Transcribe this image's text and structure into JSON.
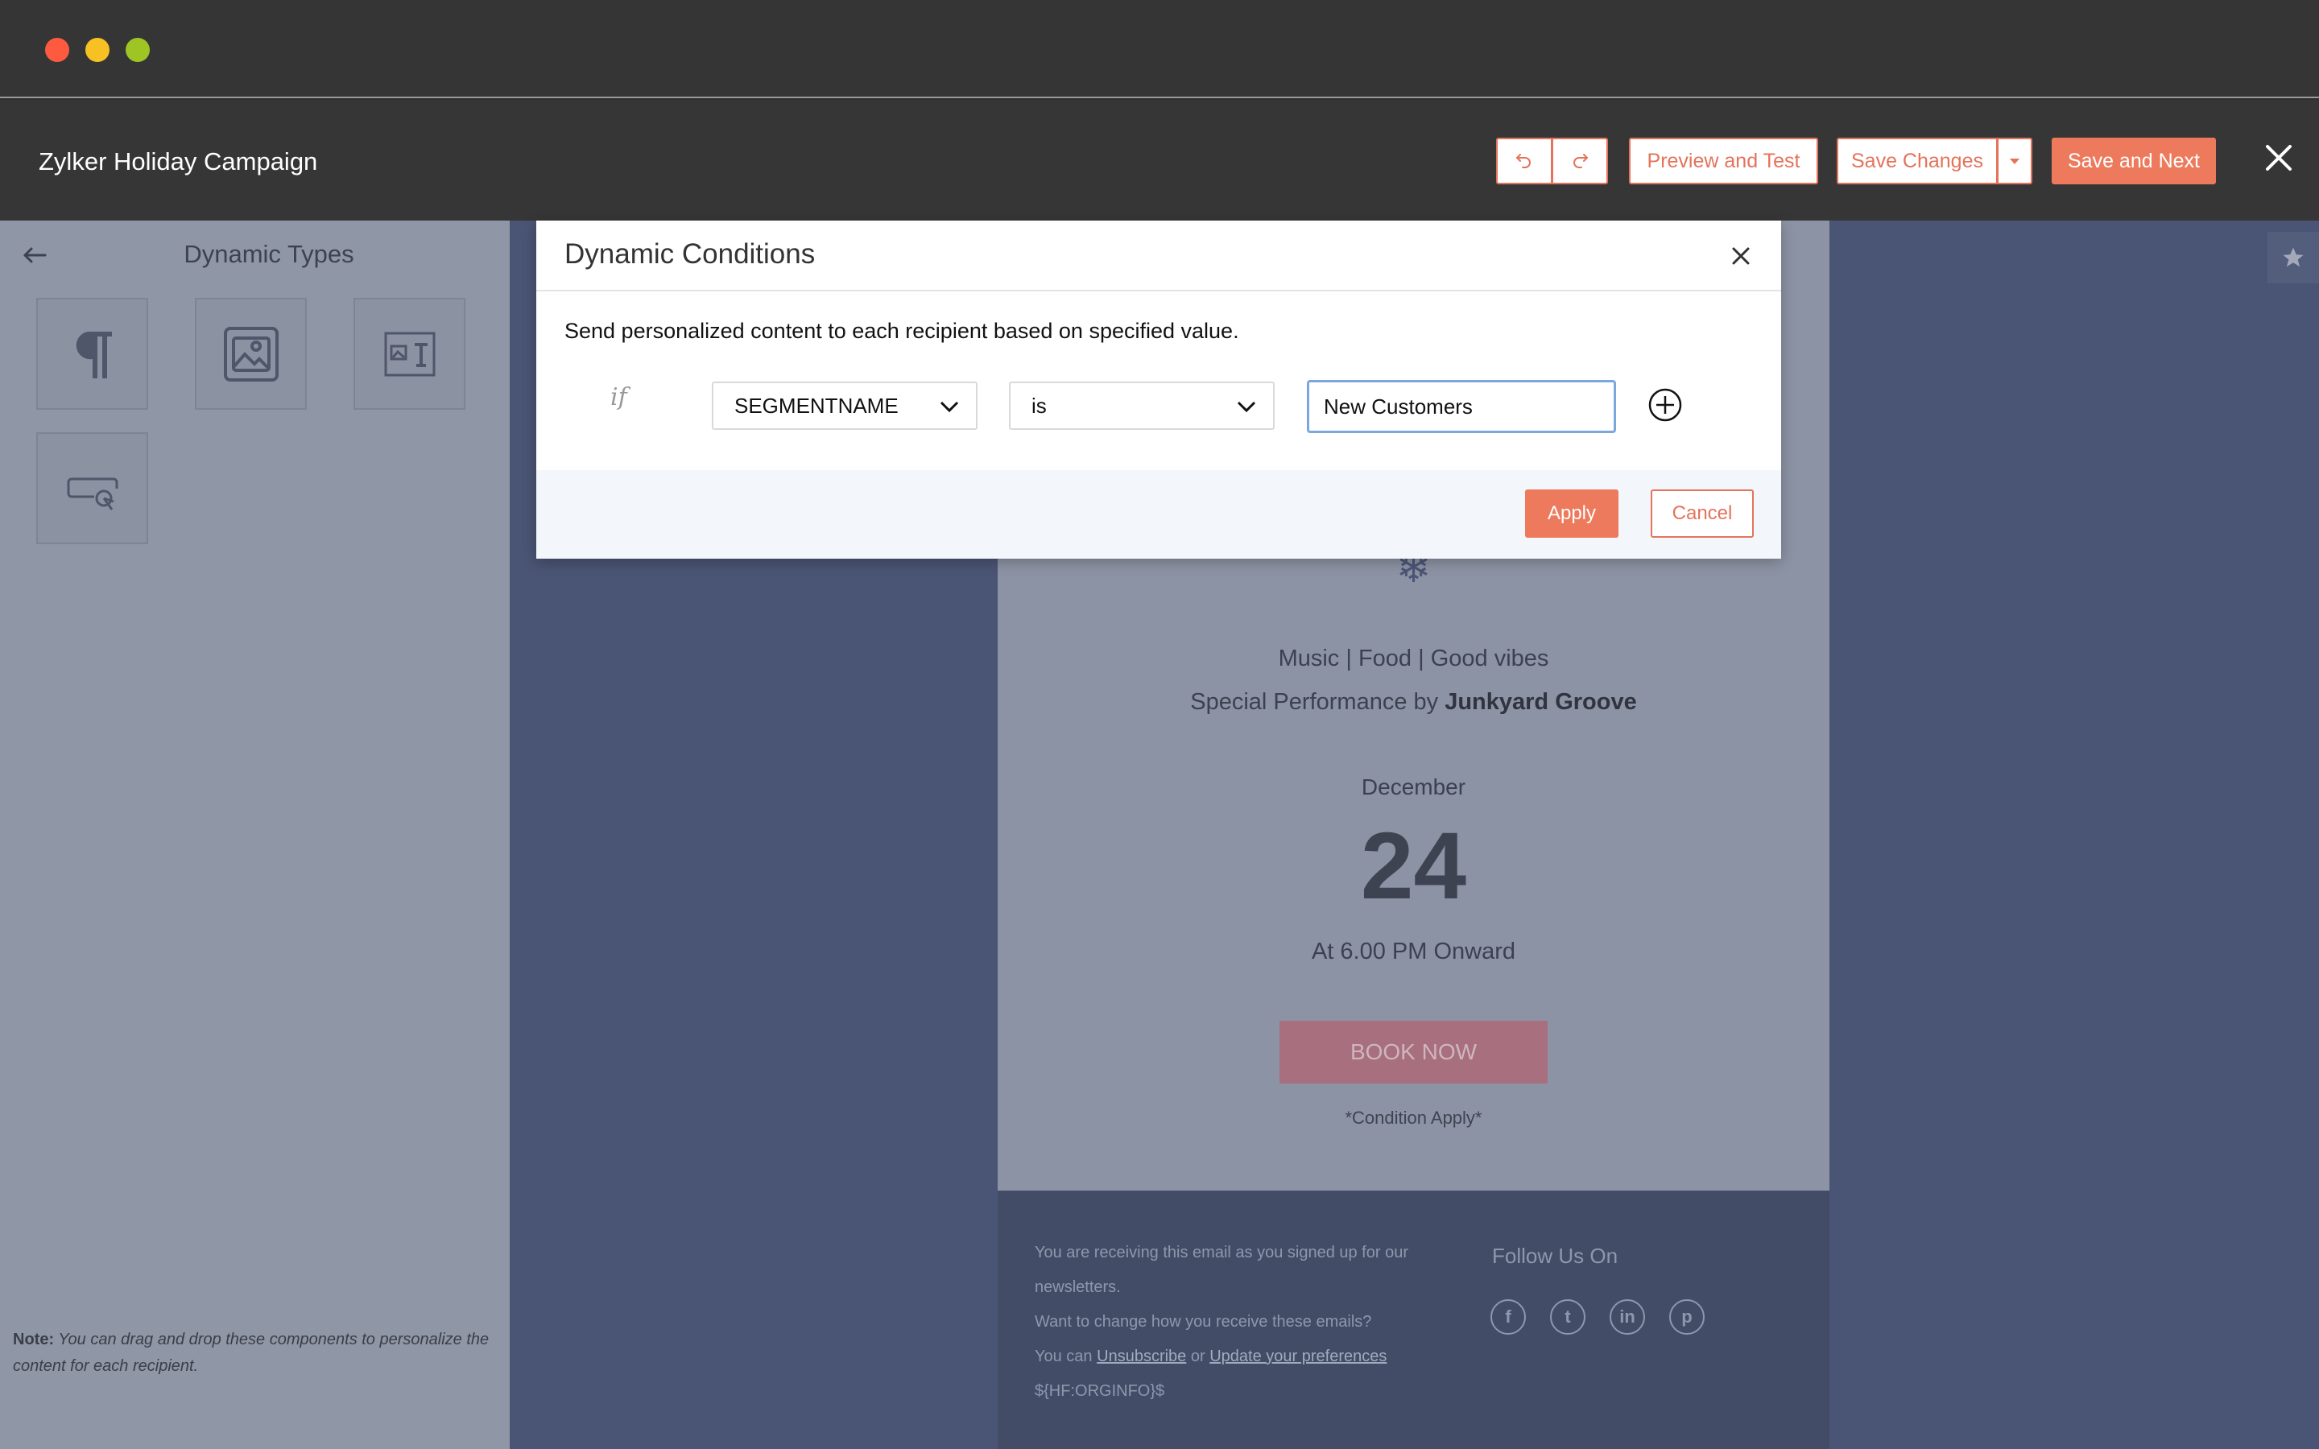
{
  "header": {
    "campaign_title": "Zylker Holiday Campaign",
    "preview_label": "Preview and Test",
    "save_label": "Save Changes",
    "save_next_label": "Save and Next"
  },
  "left_panel": {
    "title": "Dynamic Types",
    "tiles": [
      "paragraph-icon",
      "image-icon",
      "image-text-icon",
      "button-click-icon"
    ],
    "note_label": "Note:",
    "note_text": "You can drag and drop these components to personalize the content for each recipient."
  },
  "email": {
    "line1": "Music | Food | Good vibes",
    "line2_prefix": "Special Performance by",
    "line2_bold": "Junkyard Groove",
    "month": "December",
    "day": "24",
    "time": "At 6.00 PM Onward",
    "book_label": "BOOK NOW",
    "condition": "*Condition Apply*",
    "footer": {
      "line1": "You are receiving this email as you signed up for our newsletters.",
      "line2": "Want to change how you receive these emails?",
      "line3_prefix": "You can",
      "unsubscribe": "Unsubscribe",
      "line3_mid": "or",
      "update_prefs": "Update your preferences",
      "orginfo": "${HF:ORGINFO}$",
      "follow": "Follow Us On",
      "social": [
        "f",
        "t",
        "in",
        "p"
      ]
    }
  },
  "modal": {
    "title": "Dynamic Conditions",
    "description": "Send personalized content to each recipient based on specified value.",
    "if_label": "if",
    "field_value": "SEGMENTNAME",
    "operator_value": "is",
    "input_value": "New Customers",
    "apply_label": "Apply",
    "cancel_label": "Cancel"
  },
  "colors": {
    "accent": "#ed7a5c",
    "titlebar": "#353535",
    "canvas": "#4a5474"
  }
}
